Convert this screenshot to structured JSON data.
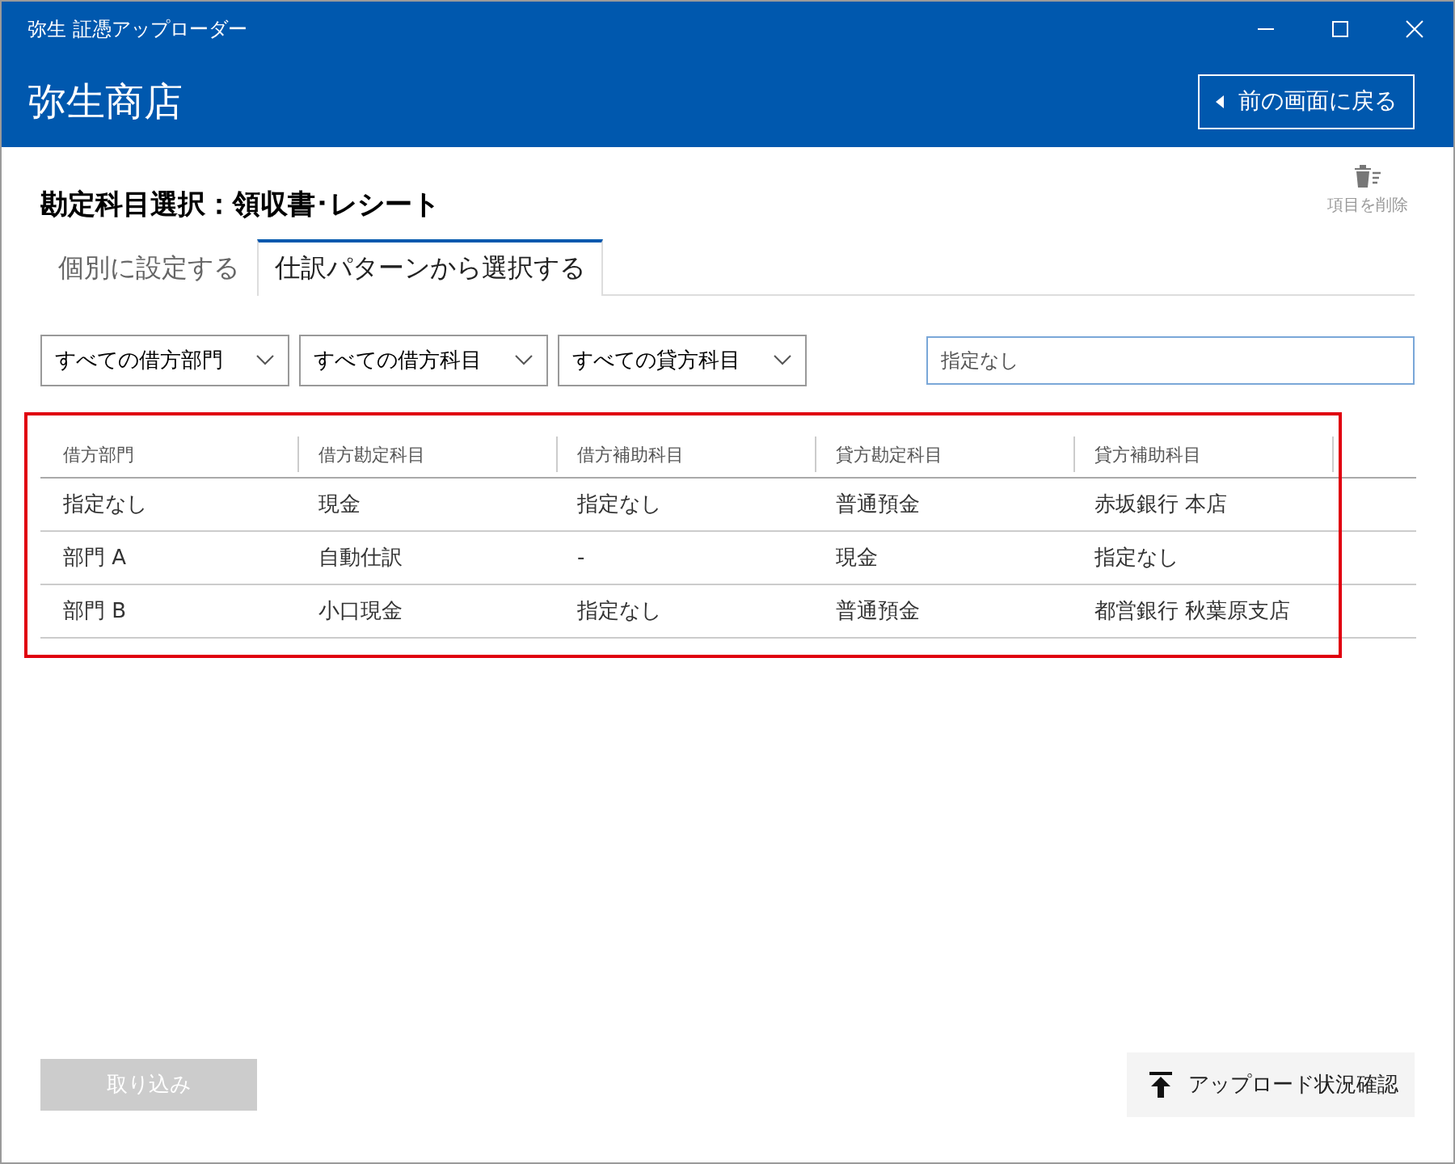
{
  "window": {
    "title": "弥生 証憑アップローダー"
  },
  "header": {
    "shop": "弥生商店",
    "back_button": "前の画面に戻る"
  },
  "page": {
    "title": "勘定科目選択：領収書･レシート",
    "delete_button": "項目を削除"
  },
  "tabs": [
    {
      "label": "個別に設定する",
      "selected": false
    },
    {
      "label": "仕訳パターンから選択する",
      "selected": true
    }
  ],
  "filters": [
    "すべての借方部門",
    "すべての借方科目",
    "すべての貸方科目"
  ],
  "search": {
    "value": "指定なし"
  },
  "table": {
    "highlighted": true,
    "columns": [
      "借方部門",
      "借方勘定科目",
      "借方補助科目",
      "貸方勘定科目",
      "貸方補助科目"
    ],
    "rows": [
      [
        "指定なし",
        "現金",
        "指定なし",
        "普通預金",
        "赤坂銀行 本店"
      ],
      [
        "部門 A",
        "自動仕訳",
        "-",
        "現金",
        "指定なし"
      ],
      [
        "部門 B",
        "小口現金",
        "指定なし",
        "普通預金",
        "都営銀行 秋葉原支店"
      ]
    ]
  },
  "footer": {
    "import_button": {
      "label": "取り込み",
      "disabled": true
    },
    "status_button": "アップロード状況確認"
  }
}
